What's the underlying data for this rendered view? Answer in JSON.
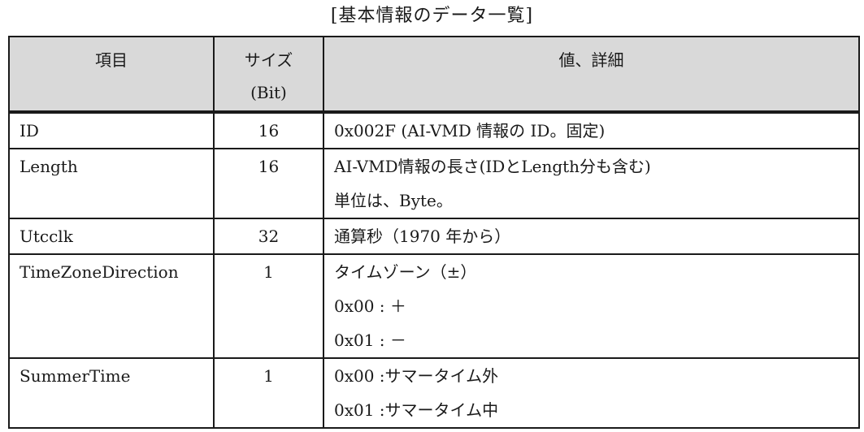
{
  "caption": "[基本情報のデータ一覧]",
  "headers": {
    "item": "項目",
    "size_line1": "サイズ",
    "size_line2": "(Bit)",
    "detail": "値、詳細"
  },
  "rows": [
    {
      "item": "ID",
      "size": "16",
      "details": [
        "0x002F (AI-VMD 情報の ID。固定)"
      ]
    },
    {
      "item": "Length",
      "size": "16",
      "details": [
        "AI-VMD情報の長さ(IDとLength分も含む)",
        "単位は、Byte。"
      ]
    },
    {
      "item": "Utcclk",
      "size": "32",
      "details": [
        "通算秒（1970 年から）"
      ]
    },
    {
      "item": "TimeZoneDirection",
      "size": "1",
      "details": [
        "タイムゾーン（±）",
        "0x00 :  ＋",
        "0x01 :  －"
      ]
    },
    {
      "item": "SummerTime",
      "size": "1",
      "details": [
        "0x00 :サマータイム外",
        "0x01 :サマータイム中"
      ]
    }
  ]
}
